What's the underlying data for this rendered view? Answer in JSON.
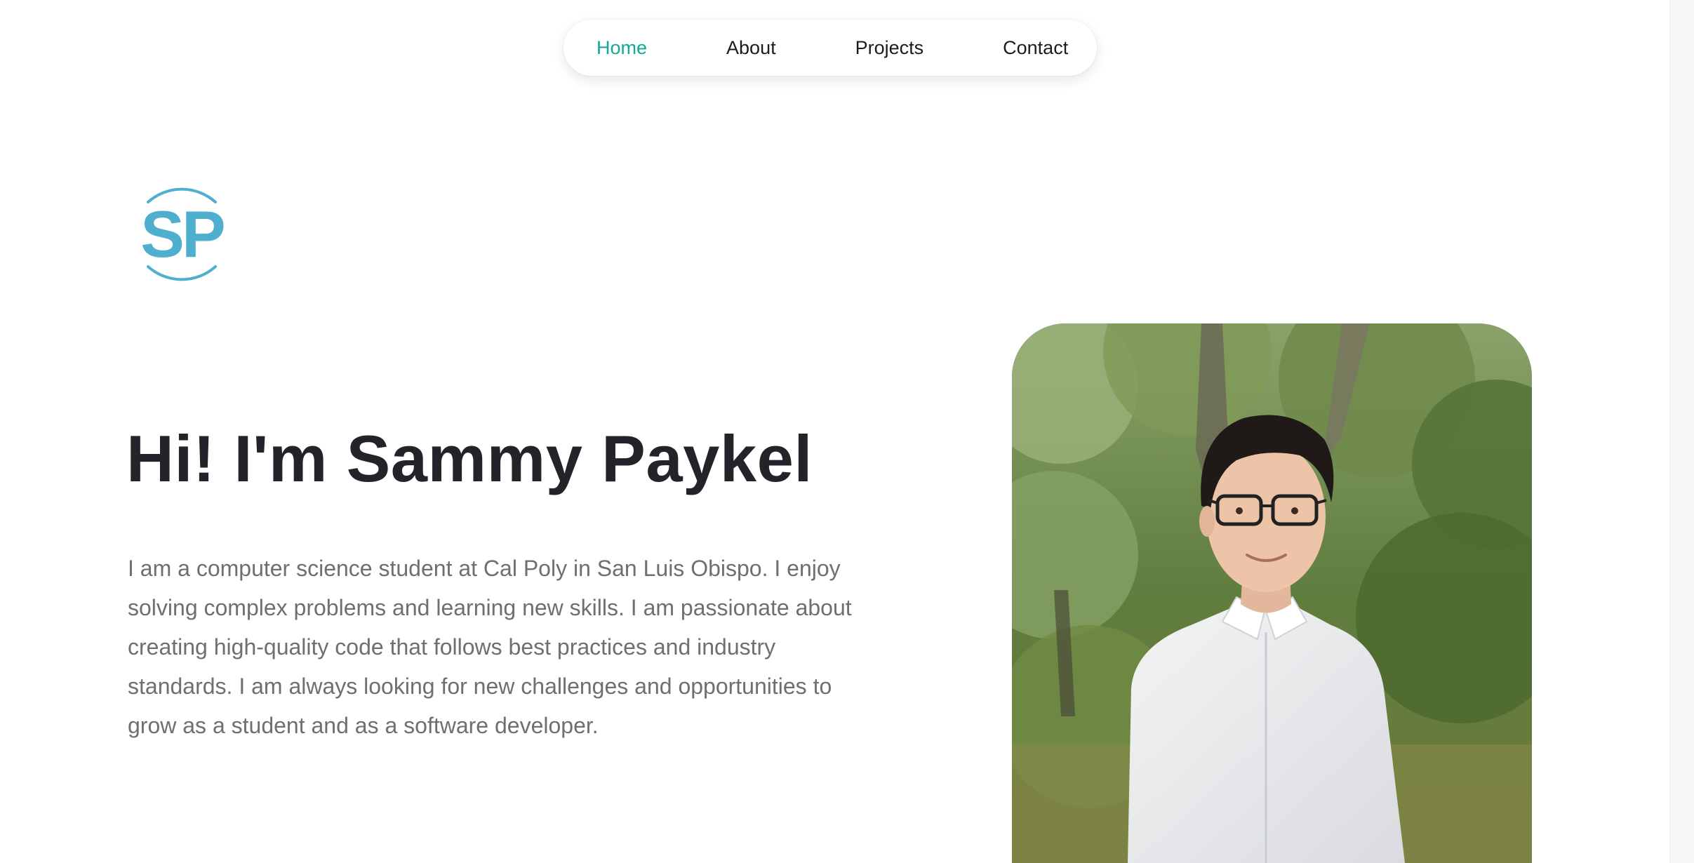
{
  "nav": {
    "items": [
      {
        "label": "Home",
        "active": true
      },
      {
        "label": "About",
        "active": false
      },
      {
        "label": "Projects",
        "active": false
      },
      {
        "label": "Contact",
        "active": false
      }
    ]
  },
  "logo": {
    "text": "SP",
    "color": "#4fafce"
  },
  "hero": {
    "title": "Hi! I'm Sammy Paykel",
    "bio": "I am a computer science student at Cal Poly in San Luis Obispo. I enjoy solving complex problems and learning new skills. I am passionate about creating high-quality code that follows best practices and industry standards. I am always looking for new challenges and opportunities to grow as a student and as a software developer."
  },
  "colors": {
    "accent": "#12a89a",
    "heading": "#222429",
    "body_text": "#6e6e73"
  }
}
